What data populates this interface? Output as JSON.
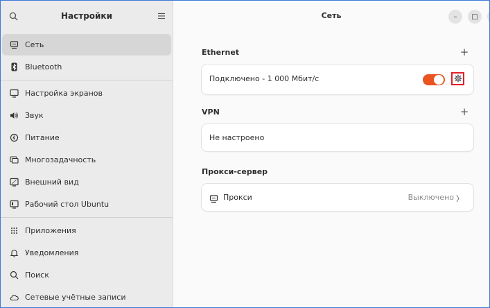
{
  "sidebar": {
    "title": "Настройки",
    "items": [
      {
        "label": "Сеть",
        "icon": "network-icon",
        "active": true
      },
      {
        "label": "Bluetooth",
        "icon": "bluetooth-icon"
      },
      {
        "label": "Настройка экранов",
        "icon": "display-icon"
      },
      {
        "label": "Звук",
        "icon": "speaker-icon"
      },
      {
        "label": "Питание",
        "icon": "power-icon"
      },
      {
        "label": "Многозадачность",
        "icon": "multitasking-icon"
      },
      {
        "label": "Внешний вид",
        "icon": "appearance-icon"
      },
      {
        "label": "Рабочий стол Ubuntu",
        "icon": "ubuntu-desktop-icon"
      },
      {
        "label": "Приложения",
        "icon": "apps-grid-icon"
      },
      {
        "label": "Уведомления",
        "icon": "bell-icon"
      },
      {
        "label": "Поиск",
        "icon": "search-icon"
      },
      {
        "label": "Сетевые учётные записи",
        "icon": "online-accounts-icon"
      }
    ]
  },
  "main": {
    "title": "Сеть",
    "ethernet": {
      "heading": "Ethernet",
      "status": "Подключено - 1 000 Мбит/с",
      "toggle_on": true
    },
    "vpn": {
      "heading": "VPN",
      "status": "Не настроено"
    },
    "proxy": {
      "heading": "Прокси-сервер",
      "label": "Прокси",
      "status": "Выключено",
      "chevron": "〉"
    }
  },
  "window_buttons": {
    "minimize": "–",
    "maximize": "□",
    "close": "×"
  },
  "colors": {
    "accent": "#e95420",
    "highlight_box": "#e0202a",
    "sidebar_bg": "#ebebeb",
    "active_item": "#d6d6d6"
  }
}
